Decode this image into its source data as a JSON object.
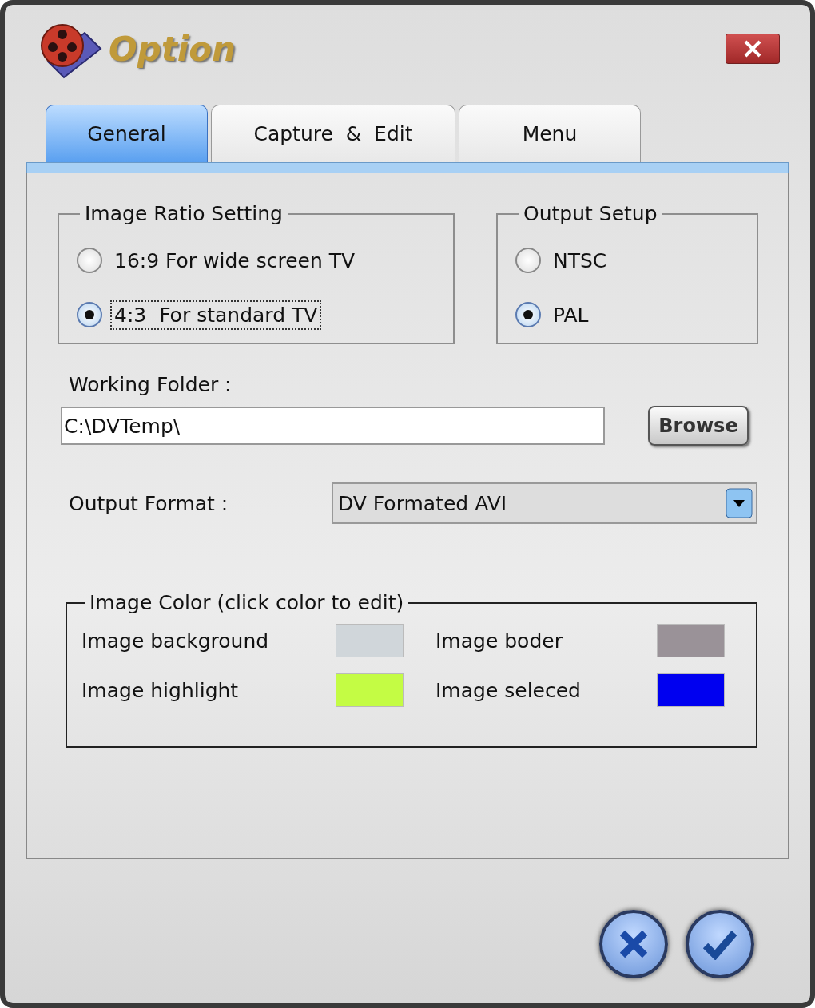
{
  "window": {
    "title": "Option"
  },
  "tabs": [
    {
      "label": "General",
      "selected": true
    },
    {
      "label": "Capture  &  Edit",
      "selected": false
    },
    {
      "label": "Menu",
      "selected": false
    }
  ],
  "image_ratio": {
    "title": "Image Ratio Setting",
    "options": [
      {
        "label": "16:9 For wide screen TV",
        "selected": false,
        "focused": false
      },
      {
        "label": "4:3  For standard TV",
        "selected": true,
        "focused": true
      }
    ]
  },
  "output_setup": {
    "title": "Output Setup",
    "options": [
      {
        "label": "NTSC",
        "selected": false,
        "focused": false
      },
      {
        "label": "PAL",
        "selected": true,
        "focused": false
      }
    ]
  },
  "working_folder": {
    "label": "Working Folder :",
    "value": "C:\\DVTemp\\",
    "button": "Browse"
  },
  "output_format": {
    "label": "Output Format :",
    "value": "DV Formated AVI"
  },
  "image_color": {
    "title": "Image Color (click color to edit)",
    "items": [
      {
        "label": "Image background",
        "color": "#d0d6da"
      },
      {
        "label": "Image boder",
        "color": "#9a9298"
      },
      {
        "label": "Image highlight",
        "color": "#c4fc44"
      },
      {
        "label": "Image seleced",
        "color": "#0000f0"
      }
    ]
  }
}
